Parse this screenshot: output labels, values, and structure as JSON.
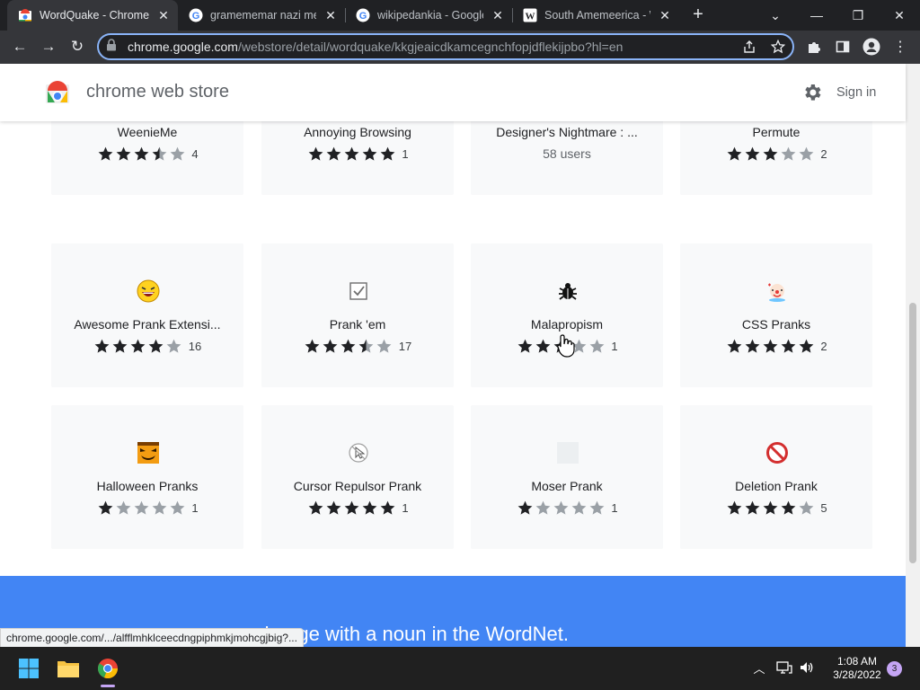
{
  "browser": {
    "tabs": [
      {
        "title": "WordQuake - Chrome Web Store",
        "active": true,
        "icon": "chrome-web-store-icon"
      },
      {
        "title": "gramememar nazi meaning",
        "active": false,
        "icon": "google-icon"
      },
      {
        "title": "wikipedankia - Google Search",
        "active": false,
        "icon": "google-icon"
      },
      {
        "title": "South Amemeerica - Wikipedia",
        "active": false,
        "icon": "wikipedia-icon"
      }
    ],
    "url_host": "chrome.google.com",
    "url_path": "/webstore/detail/wordquake/kkgjeaicdkamcegnchfopjdflekijpbo?hl=en"
  },
  "store": {
    "name": "chrome web store",
    "signin_label": "Sign in"
  },
  "cards": [
    {
      "name": "WeenieMe",
      "stars": 3.5,
      "count": "4",
      "icon": "weenie-icon"
    },
    {
      "name": "Annoying Browsing",
      "stars": 5,
      "count": "1",
      "icon": "annoying-browsing-icon"
    },
    {
      "name": "Designer's Nightmare : ...",
      "users": "58 users",
      "icon": "placeholder-icon"
    },
    {
      "name": "Permute",
      "stars": 3,
      "count": "2",
      "icon": "dice-icon"
    },
    {
      "name": "Awesome Prank Extensi...",
      "stars": 4,
      "count": "16",
      "icon": "laughing-face-icon"
    },
    {
      "name": "Prank 'em",
      "stars": 3.5,
      "count": "17",
      "icon": "checkbox-icon"
    },
    {
      "name": "Malapropism",
      "stars": 2.5,
      "count": "1",
      "icon": "bug-icon"
    },
    {
      "name": "CSS Pranks",
      "stars": 5,
      "count": "2",
      "icon": "clown-icon"
    },
    {
      "name": "Halloween Pranks",
      "stars": 1,
      "count": "1",
      "icon": "pumpkin-icon"
    },
    {
      "name": "Cursor Repulsor Prank",
      "stars": 5,
      "count": "1",
      "icon": "cursor-repulsor-icon"
    },
    {
      "name": "Moser Prank",
      "stars": 1,
      "count": "1",
      "icon": "placeholder-icon"
    },
    {
      "name": "Deletion Prank",
      "stars": 4,
      "count": "5",
      "icon": "no-entry-icon"
    }
  ],
  "banner": {
    "text": "uns on a webpage with a noun in the WordNet."
  },
  "status_url": "chrome.google.com/.../alfflmhklceecdngpiphmkjmohcgjbig?...",
  "taskbar": {
    "time": "1:08 AM",
    "date": "3/28/2022",
    "notifications": "3"
  },
  "colors": {
    "accent": "#4285f4",
    "omnibox_focus": "#8ab4f8",
    "star_filled": "#202124",
    "star_empty": "#9aa0a6"
  }
}
